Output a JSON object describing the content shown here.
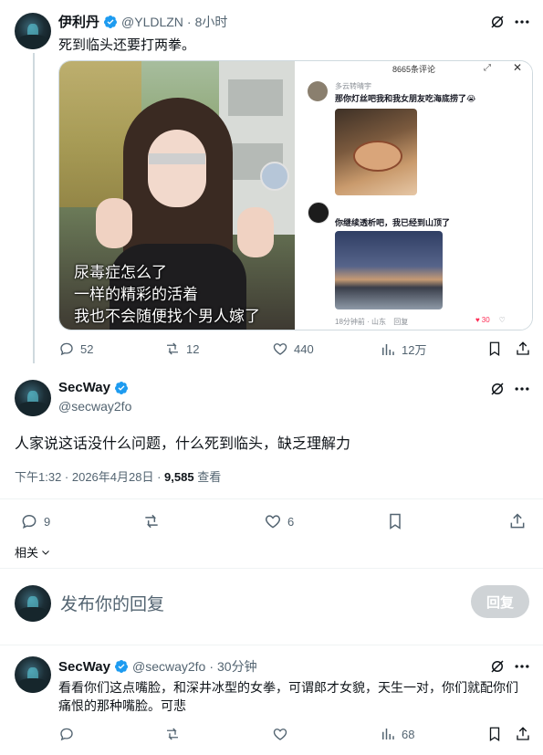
{
  "tweet1": {
    "name": "伊利丹",
    "handle": "@YLDLZN",
    "time": "8小时",
    "text": "死到临头还要打两拳。",
    "media": {
      "left_overlay_lines": [
        "尿毒症怎么了",
        "一样的精彩的活着",
        "我也不会随便找个男人嫁了"
      ],
      "panel_title": "8665条评论",
      "comment1_user": "多云转晴宇",
      "comment1_text": "那你灯丝吧我和我女朋友吃海底捞了😭",
      "comment2_text": "你继续透析吧，我已经到山顶了",
      "meta_time": "18分钟前 · 山东",
      "meta_reply": "回复",
      "likes": "30"
    },
    "replies": "52",
    "retweets": "12",
    "likes": "440",
    "views": "12万"
  },
  "main_tweet": {
    "name": "SecWay",
    "handle": "@secway2fo",
    "text": "人家说这话没什么问题，什么死到临头，缺乏理解力",
    "timestamp": "下午1:32 · 2026年4月28日 · ",
    "views_count": "9,585",
    "views_label": " 查看",
    "replies": "9",
    "likes": "6",
    "related": "相关"
  },
  "compose": {
    "placeholder": "发布你的回复",
    "button": "回复"
  },
  "reply_tweet": {
    "name": "SecWay",
    "handle": "@secway2fo",
    "time": "30分钟",
    "text": "看看你们这点嘴脸，和深井冰型的女拳，可谓郎才女貌，天生一对，你们就配你们痛恨的那种嘴脸。可悲",
    "views": "68"
  },
  "colors": {
    "accent": "#1d9bf0",
    "muted": "#536471",
    "button_disabled": "#cfd3d6"
  }
}
